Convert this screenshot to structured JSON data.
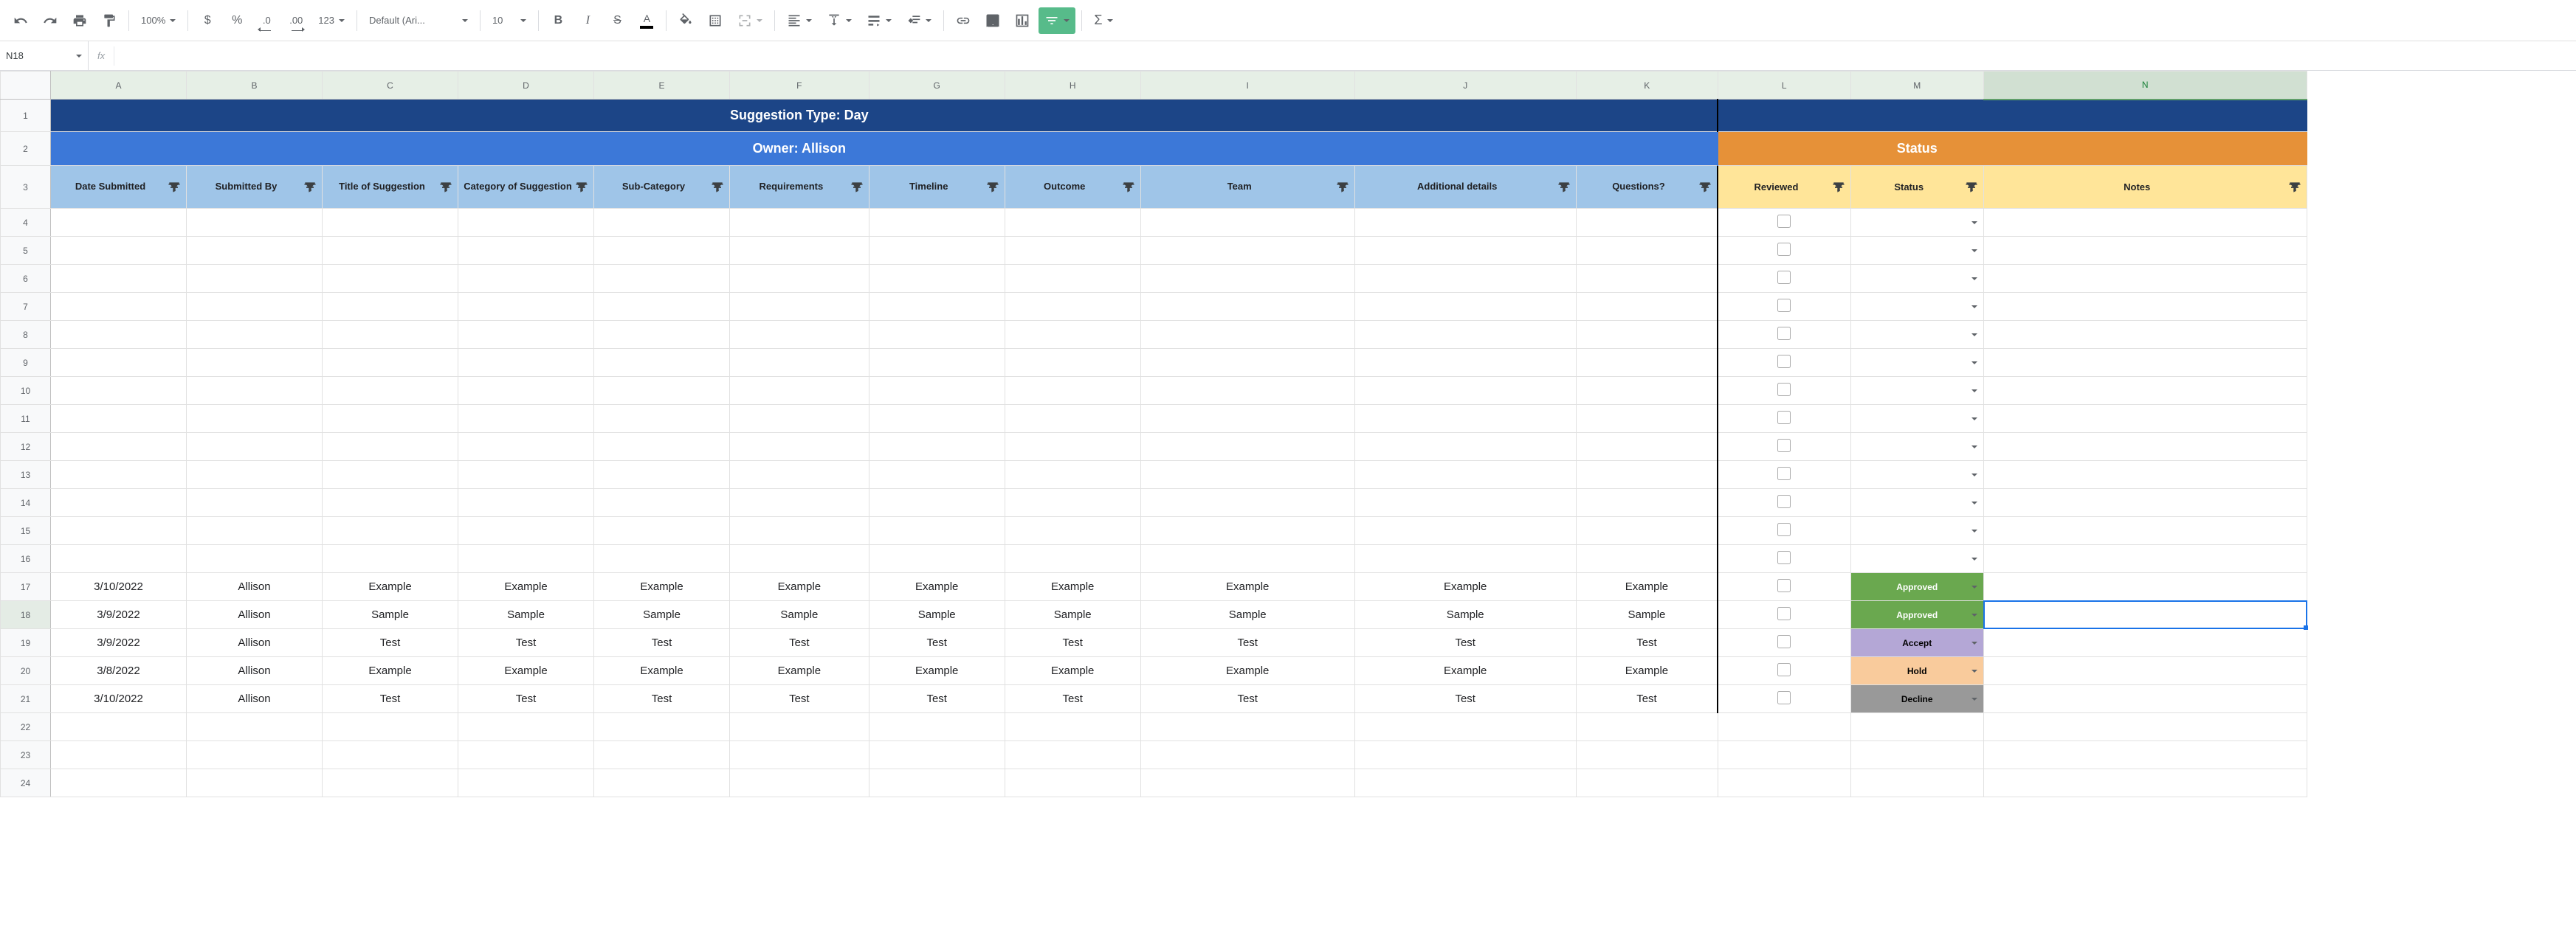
{
  "toolbar": {
    "zoom": "100%",
    "currency": "$",
    "percent": "%",
    "dec_less": ".0",
    "dec_more": ".00",
    "num_fmt": "123",
    "font": "Default (Ari...",
    "font_size": "10"
  },
  "name_box": "N18",
  "fx_label": "fx",
  "formula_value": "",
  "columns": [
    "A",
    "B",
    "C",
    "D",
    "E",
    "F",
    "G",
    "H",
    "I",
    "J",
    "K",
    "L",
    "M",
    "N"
  ],
  "row_nums": [
    1,
    2,
    3,
    4,
    5,
    6,
    7,
    8,
    9,
    10,
    11,
    12,
    13,
    14,
    15,
    16,
    17,
    18,
    19,
    20,
    21,
    22,
    23,
    24
  ],
  "header_row1_title": "Suggestion Type: Day",
  "header_row2_left": "Owner: Allison",
  "header_row2_right": "Status",
  "headers_row3_left": [
    "Date Submitted",
    "Submitted By",
    "Title of Suggestion",
    "Category of Suggestion",
    "Sub-Category",
    "Requirements",
    "Timeline",
    "Outcome",
    "Team",
    "Additional details",
    "Questions?"
  ],
  "headers_row3_right": [
    "Reviewed",
    "Status",
    "Notes"
  ],
  "data_rows": [
    {
      "row": 17,
      "cells": [
        "3/10/2022",
        "Allison",
        "Example",
        "Example",
        "Example",
        "Example",
        "Example",
        "Example",
        "Example",
        "Example",
        "Example"
      ],
      "status": "Approved",
      "status_class": "status-approved"
    },
    {
      "row": 18,
      "cells": [
        "3/9/2022",
        "Allison",
        "Sample",
        "Sample",
        "Sample",
        "Sample",
        "Sample",
        "Sample",
        "Sample",
        "Sample",
        "Sample"
      ],
      "status": "Approved",
      "status_class": "status-approved"
    },
    {
      "row": 19,
      "cells": [
        "3/9/2022",
        "Allison",
        "Test",
        "Test",
        "Test",
        "Test",
        "Test",
        "Test",
        "Test",
        "Test",
        "Test"
      ],
      "status": "Accept",
      "status_class": "status-accept"
    },
    {
      "row": 20,
      "cells": [
        "3/8/2022",
        "Allison",
        "Example",
        "Example",
        "Example",
        "Example",
        "Example",
        "Example",
        "Example",
        "Example",
        "Example"
      ],
      "status": "Hold",
      "status_class": "status-hold"
    },
    {
      "row": 21,
      "cells": [
        "3/10/2022",
        "Allison",
        "Test",
        "Test",
        "Test",
        "Test",
        "Test",
        "Test",
        "Test",
        "Test",
        "Test"
      ],
      "status": "Decline",
      "status_class": "status-decline"
    }
  ]
}
